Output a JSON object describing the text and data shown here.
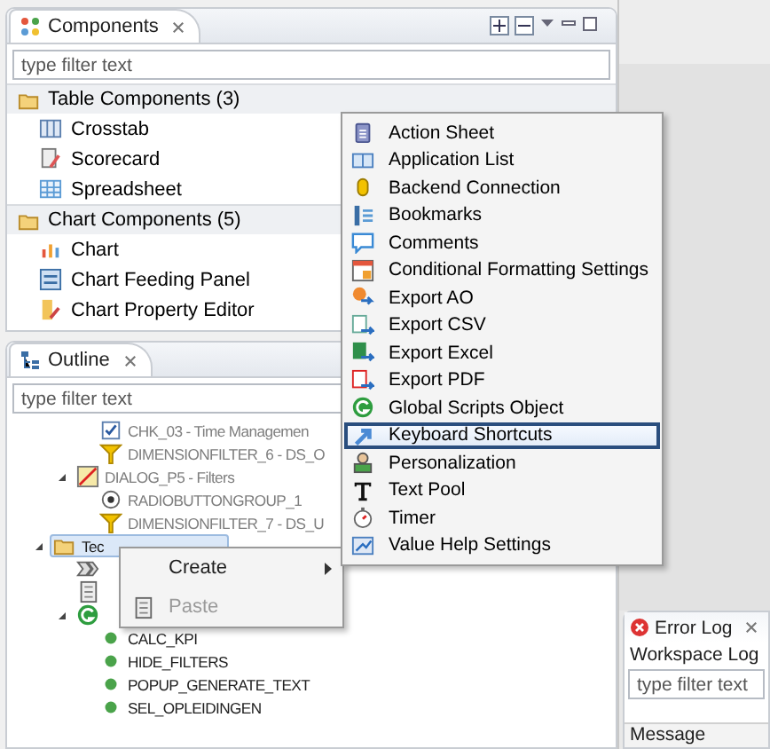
{
  "components": {
    "title": "Components",
    "filter": {
      "placeholder": "type filter text"
    },
    "groups": [
      {
        "label": "Table Components (3)",
        "items": [
          {
            "label": "Crosstab",
            "kind": "grid-cols"
          },
          {
            "label": "Scorecard",
            "kind": "scorecard"
          },
          {
            "label": "Spreadsheet",
            "kind": "grid"
          }
        ]
      },
      {
        "label": "Chart Components (5)",
        "items": [
          {
            "label": "Chart",
            "kind": "chart"
          },
          {
            "label": "Chart Feeding Panel",
            "kind": "panel"
          },
          {
            "label": "Chart Property Editor",
            "kind": "editor"
          }
        ]
      }
    ]
  },
  "outline": {
    "title": "Outline",
    "filter": {
      "placeholder": "type filter text"
    },
    "tree": [
      {
        "children": [
          {
            "children": [
              {
                "label": "CHK_03 - Time Managemen",
                "kind": "checkbox",
                "dimmed": true
              },
              {
                "label": "DIMENSIONFILTER_6 - DS_O",
                "kind": "funnel",
                "dimmed": true
              }
            ]
          },
          {
            "label": "DIALOG_P5 - Filters",
            "kind": "dialog",
            "dimmed": true,
            "expanded": true,
            "children": [
              {
                "label": "RADIOBUTTONGROUP_1",
                "kind": "radio",
                "dimmed": true
              },
              {
                "label": "DIMENSIONFILTER_7 - DS_U",
                "kind": "funnel",
                "dimmed": true
              }
            ]
          }
        ]
      },
      {
        "label": "Tec",
        "kind": "folder",
        "dimmed": false,
        "selected": true,
        "expanded": true,
        "children": [
          {
            "kind": "script",
            "dimmed": false
          },
          {
            "kind": "document",
            "dimmed": false
          },
          {
            "kind": "global",
            "dimmed": false,
            "expanded": true,
            "children": [
              {
                "label": "CALC_KPI",
                "kind": "dot",
                "dimmed": false
              },
              {
                "label": "HIDE_FILTERS",
                "kind": "dot",
                "dimmed": false
              },
              {
                "label": "POPUP_GENERATE_TEXT",
                "kind": "dot",
                "dimmed": false
              },
              {
                "label": "SEL_OPLEIDINGEN",
                "kind": "dot",
                "dimmed": false
              }
            ]
          }
        ]
      }
    ]
  },
  "context_menu": [
    {
      "label": "Create",
      "disabled": false,
      "submenu": true
    },
    {
      "label": "Paste",
      "disabled": true,
      "submenu": false
    }
  ],
  "submenu": [
    {
      "label": "Action Sheet",
      "kind": "clipboard",
      "selected": false
    },
    {
      "label": "Application List",
      "kind": "book",
      "selected": false
    },
    {
      "label": "Backend Connection",
      "kind": "cylinder",
      "selected": false
    },
    {
      "label": "Bookmarks",
      "kind": "bookmarks",
      "selected": false
    },
    {
      "label": "Comments",
      "kind": "bubble",
      "selected": false
    },
    {
      "label": "Conditional Formatting Settings",
      "kind": "table",
      "selected": false
    },
    {
      "label": "Export AO",
      "kind": "export-ao",
      "selected": false
    },
    {
      "label": "Export CSV",
      "kind": "export-csv",
      "selected": false
    },
    {
      "label": "Export Excel",
      "kind": "export-excel",
      "selected": false
    },
    {
      "label": "Export PDF",
      "kind": "export-pdf",
      "selected": false
    },
    {
      "label": "Global Scripts Object",
      "kind": "global",
      "selected": false
    },
    {
      "label": "Keyboard Shortcuts",
      "kind": "shortcut",
      "selected": true
    },
    {
      "label": "Personalization",
      "kind": "person",
      "selected": false
    },
    {
      "label": "Text Pool",
      "kind": "letter-t",
      "selected": false
    },
    {
      "label": "Timer",
      "kind": "stopwatch",
      "selected": false
    },
    {
      "label": "Value Help Settings",
      "kind": "help",
      "selected": false
    }
  ],
  "error_log": {
    "title": "Error Log",
    "subtitle": "Workspace Log",
    "filter": {
      "placeholder": "type filter text"
    },
    "column": "Message"
  }
}
